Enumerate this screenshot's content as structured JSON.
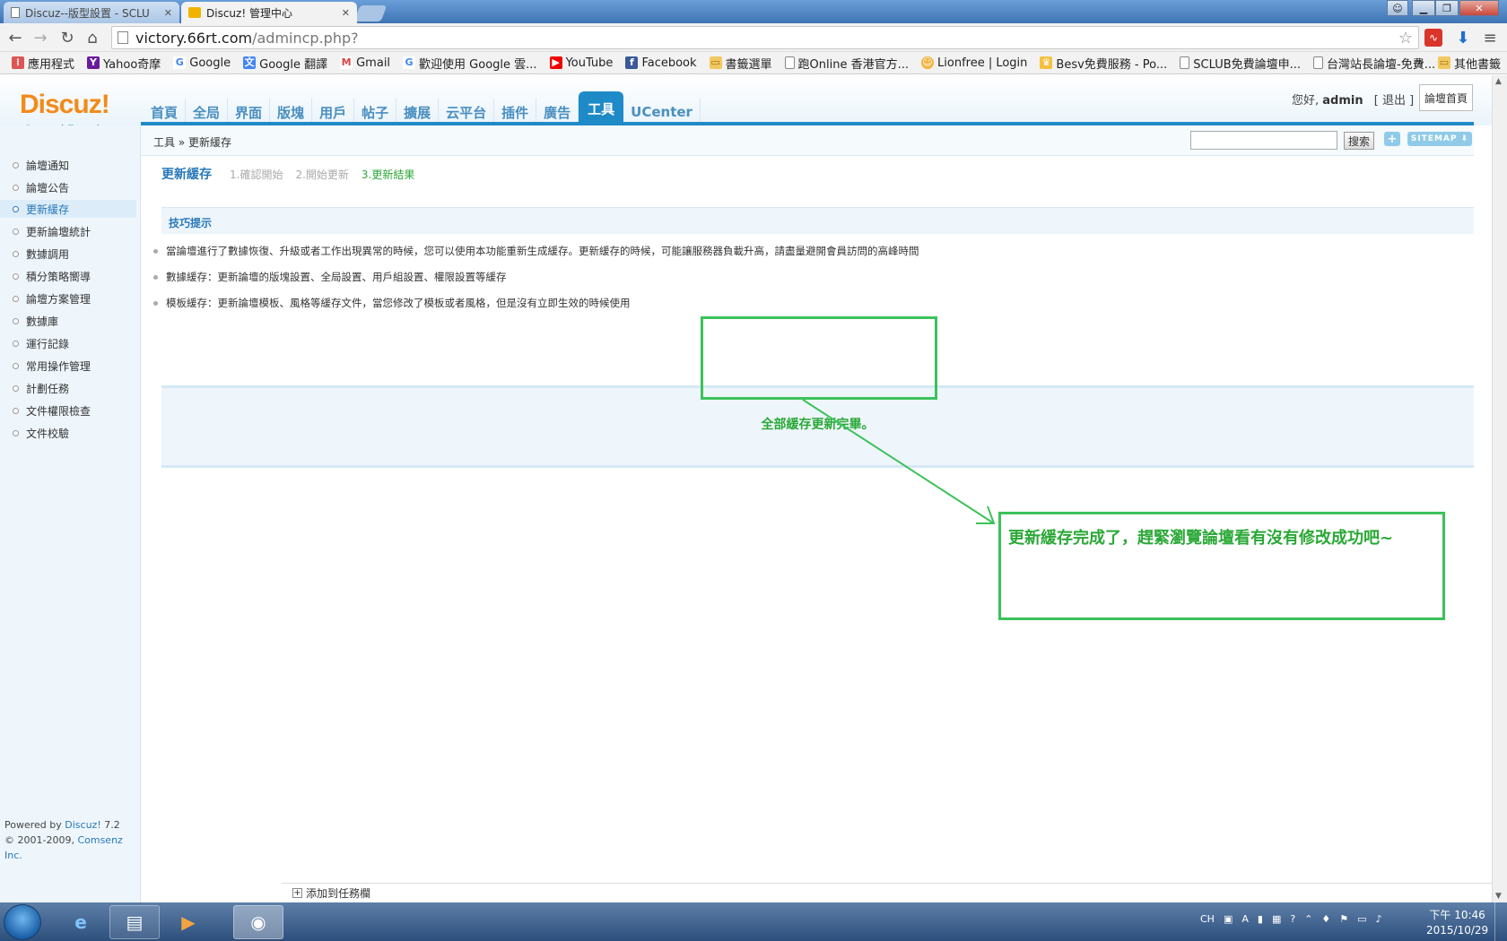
{
  "browser": {
    "tabs": [
      {
        "title": "Discuz--版型設置 - SCLU",
        "active": false
      },
      {
        "title": "Discuz! 管理中心",
        "active": true
      }
    ],
    "url_host": "victory.66rt.com",
    "url_path": "/admincp.php?",
    "bookmarks": [
      "應用程式",
      "Yahoo奇摩",
      "Google",
      "Google 翻譯",
      "Gmail",
      "歡迎使用 Google 雲...",
      "YouTube",
      "Facebook",
      "書籤選單",
      "跑Online 香港官方...",
      "Lionfree | Login",
      "Besv免費服務 - Po...",
      "SCLUB免費論壇申...",
      "台灣站長論壇-免費..."
    ],
    "bookmarks_more": "»",
    "other_bookmarks": "其他書籤"
  },
  "header": {
    "logo": "Discuz!",
    "logo_sub": "Control Panel",
    "nav": [
      "首頁",
      "全局",
      "界面",
      "版塊",
      "用戶",
      "帖子",
      "擴展",
      "云平台",
      "插件",
      "廣告",
      "工具",
      "UCenter"
    ],
    "active_nav": "工具",
    "greeting": "您好,",
    "username": "admin",
    "logout": "[ 退出 ]",
    "forum_home": "論壇首頁"
  },
  "breadcrumb": {
    "root": "工具",
    "sep": "»",
    "current": "更新緩存"
  },
  "search": {
    "value": "",
    "button": "搜索",
    "plus": "+",
    "sitemap": "SITEMAP ⬇"
  },
  "sidebar": {
    "items": [
      "論壇通知",
      "論壇公告",
      "更新緩存",
      "更新論壇統計",
      "數據調用",
      "積分策略嚮導",
      "論壇方案管理",
      "數據庫",
      "運行記錄",
      "常用操作管理",
      "計劃任務",
      "文件權限檢查",
      "文件校驗"
    ],
    "active": "更新緩存",
    "powered_prefix": "Powered by ",
    "powered_link": "Discuz!",
    "powered_version": " 7.2",
    "copyright_prefix": "© 2001-2009, ",
    "copyright_link": "Comsenz Inc."
  },
  "main": {
    "title": "更新緩存",
    "steps": [
      "1.確認開始",
      "2.開始更新",
      "3.更新結果"
    ],
    "current_step": 3,
    "tips_title": "技巧提示",
    "tips": [
      "當論壇進行了數據恢復、升級或者工作出現異常的時候，您可以使用本功能重新生成緩存。更新緩存的時候，可能讓服務器負載升高，請盡量避開會員訪問的高峰時間",
      "數據緩存：更新論壇的版塊設置、全局設置、用戶組設置、權限設置等緩存",
      "模板緩存：更新論壇模板、風格等緩存文件，當您修改了模板或者風格，但是沒有立即生效的時候使用"
    ],
    "result_message": "全部緩存更新完畢。",
    "annotation_note": "更新緩存完成了，趕緊瀏覽論壇看有沒有修改成功吧~",
    "add_task": "添加到任務欄"
  },
  "taskbar": {
    "tray_lang": "CH",
    "time": "下午 10:46",
    "date": "2015/10/29"
  },
  "colors": {
    "accent": "#1f8ac8",
    "link": "#2878b8",
    "annotation_green": "#3cc25a",
    "logo_orange": "#f28b1a"
  }
}
